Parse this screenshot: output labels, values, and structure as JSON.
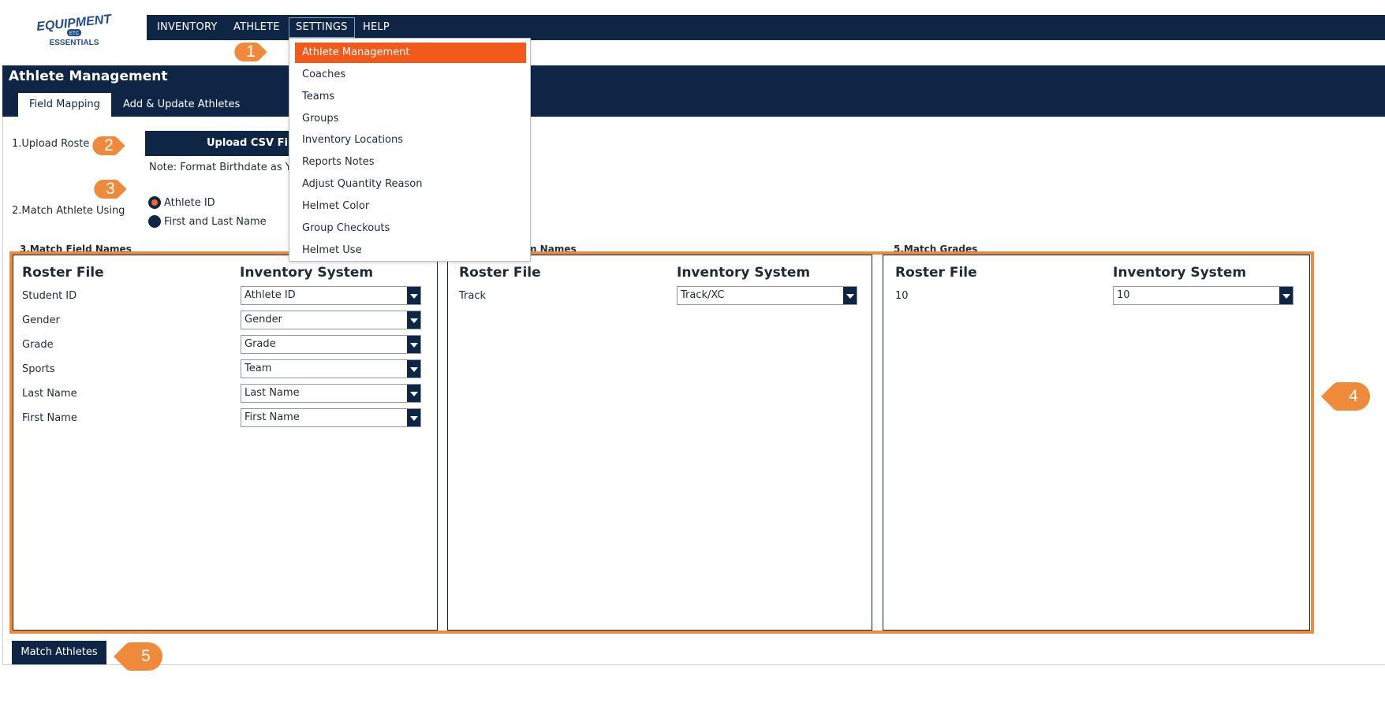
{
  "logo": {
    "line1": "EQUIPMENT",
    "badge": "ETC",
    "line2": "ESSENTIALS"
  },
  "nav": {
    "items": [
      "INVENTORY",
      "ATHLETE",
      "SETTINGS",
      "HELP"
    ]
  },
  "settings_menu": {
    "items": [
      "Athlete Management",
      "Coaches",
      "Teams",
      "Groups",
      "Inventory Locations",
      "Reports Notes",
      "Adjust Quantity Reason",
      "Helmet Color",
      "Group Checkouts",
      "Helmet Use"
    ]
  },
  "page": {
    "title": "Athlete Management",
    "tabs": [
      "Field Mapping",
      "Add & Update Athletes"
    ]
  },
  "step1": {
    "label": "1.Upload Roste",
    "button": "Upload CSV File",
    "note": "Note: Format Birthdate as Y"
  },
  "step2": {
    "label": "2.Match Athlete Using",
    "options": [
      "Athlete ID",
      "First and Last Name"
    ],
    "selected": "Athlete ID"
  },
  "sections": {
    "s3": "3.Match Field Names",
    "s4": "m Names",
    "s5": "5.Match Grades"
  },
  "field_panel": {
    "col1": "Roster File",
    "col2": "Inventory System",
    "rows": [
      {
        "roster": "Student ID",
        "system": "Athlete ID"
      },
      {
        "roster": "Gender",
        "system": "Gender"
      },
      {
        "roster": "Grade",
        "system": "Grade"
      },
      {
        "roster": "Sports",
        "system": "Team"
      },
      {
        "roster": "Last Name",
        "system": "Last Name"
      },
      {
        "roster": "First Name",
        "system": "First Name"
      }
    ]
  },
  "team_panel": {
    "col1": "Roster File",
    "col2": "Inventory System",
    "rows": [
      {
        "roster": "Track",
        "system": "Track/XC"
      }
    ]
  },
  "grade_panel": {
    "col1": "Roster File",
    "col2": "Inventory System",
    "rows": [
      {
        "roster": "10",
        "system": "10"
      }
    ]
  },
  "match_button": "Match Athletes",
  "callouts": [
    "1",
    "2",
    "3",
    "4",
    "5"
  ],
  "colors": {
    "navy": "#0f2545",
    "accent": "#f15a1b",
    "callout": "#ef8a3a"
  }
}
